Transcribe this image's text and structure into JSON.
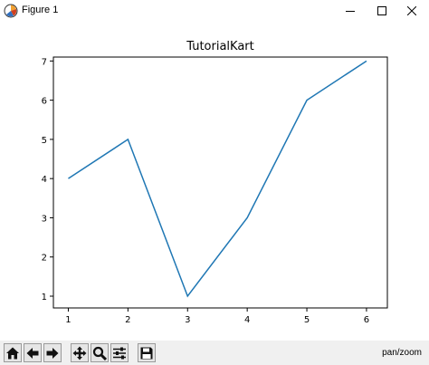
{
  "window": {
    "title": "Figure 1"
  },
  "toolbar": {
    "buttons": [
      {
        "icon": "home-icon",
        "label": "Home"
      },
      {
        "icon": "back-arrow-icon",
        "label": "Back"
      },
      {
        "icon": "forward-arrow-icon",
        "label": "Forward"
      },
      {
        "icon": "pan-move-icon",
        "label": "Pan"
      },
      {
        "icon": "zoom-magnifier-icon",
        "label": "Zoom"
      },
      {
        "icon": "subplots-config-icon",
        "label": "Subplots"
      },
      {
        "icon": "save-floppy-icon",
        "label": "Save"
      }
    ],
    "status": "pan/zoom"
  },
  "chart_data": {
    "type": "line",
    "title": "TutorialKart",
    "xlabel": "",
    "ylabel": "",
    "x": [
      1,
      2,
      3,
      4,
      5,
      6
    ],
    "series": [
      {
        "values": [
          4,
          5,
          1,
          3,
          6,
          7
        ],
        "color": "#1f77b4"
      }
    ],
    "xticks": [
      "1",
      "2",
      "3",
      "4",
      "5",
      "6"
    ],
    "yticks": [
      "1",
      "2",
      "3",
      "4",
      "5",
      "6",
      "7"
    ],
    "xlim": [
      0.75,
      6.35
    ],
    "ylim": [
      0.7,
      7.1
    ],
    "grid": false
  }
}
